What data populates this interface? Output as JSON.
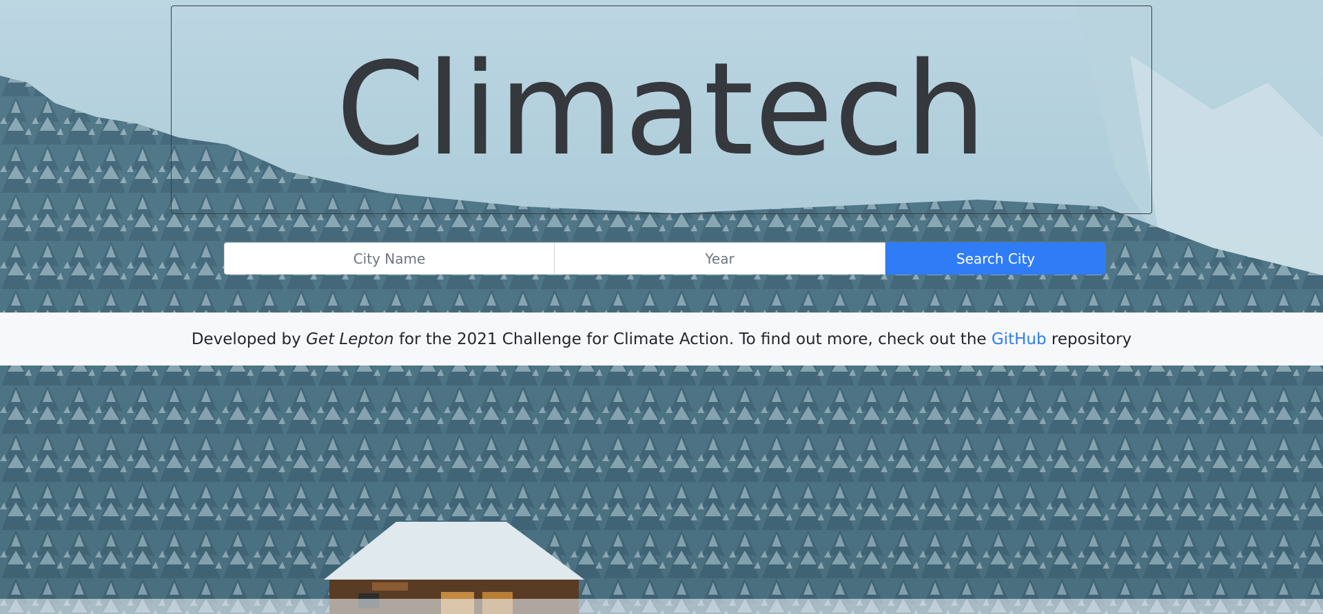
{
  "hero": {
    "title": "Climatech"
  },
  "search": {
    "city_placeholder": "City Name",
    "year_placeholder": "Year",
    "button_label": "Search City"
  },
  "footer": {
    "prefix": "Developed by ",
    "team_name": "Get Lepton",
    "middle": " for the 2021 Challenge for Climate Action. To find out more, check out the ",
    "link_label": "GitHub",
    "suffix": " repository"
  },
  "colors": {
    "accent": "#2f7cf6",
    "title_text": "#35383d",
    "footer_bg": "#f7f8fa"
  }
}
